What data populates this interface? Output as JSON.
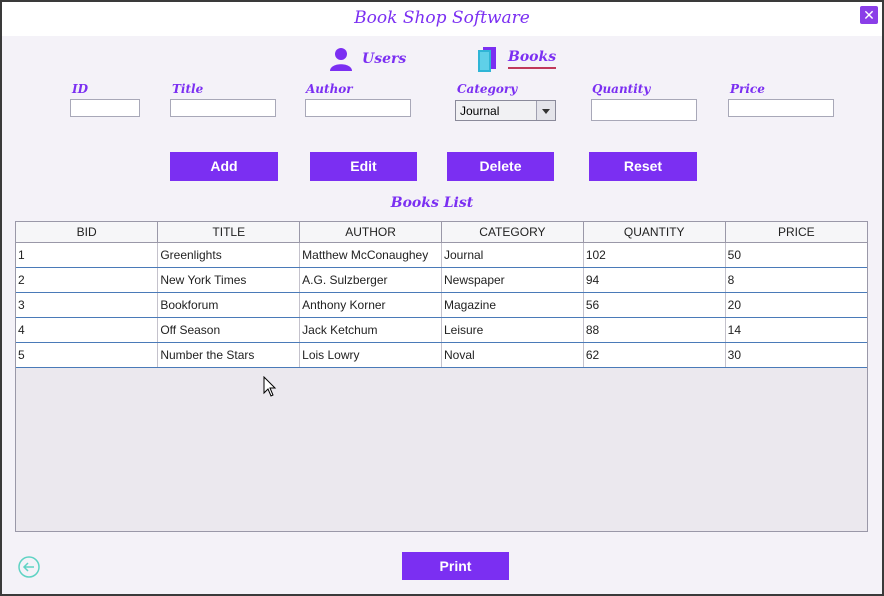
{
  "app": {
    "title": "Book Shop Software",
    "close_glyph": "✕"
  },
  "nav": {
    "users_label": "Users",
    "books_label": "Books"
  },
  "form": {
    "id_label": "ID",
    "title_label": "Title",
    "author_label": "Author",
    "category_label": "Category",
    "quantity_label": "Quantity",
    "price_label": "Price",
    "id_value": "",
    "title_value": "",
    "author_value": "",
    "category_value": "Journal",
    "quantity_value": "",
    "price_value": ""
  },
  "buttons": {
    "add": "Add",
    "edit": "Edit",
    "delete": "Delete",
    "reset": "Reset",
    "print": "Print"
  },
  "list": {
    "title": "Books List",
    "columns": [
      "BID",
      "TITLE",
      "AUTHOR",
      "CATEGORY",
      "QUANTITY",
      "PRICE"
    ],
    "rows": [
      [
        "1",
        "Greenlights",
        "Matthew McConaughey",
        "Journal",
        "102",
        "50"
      ],
      [
        "2",
        "New York Times",
        "A.G. Sulzberger",
        "Newspaper",
        "94",
        "8"
      ],
      [
        "3",
        "Bookforum",
        "Anthony Korner",
        "Magazine",
        "56",
        "20"
      ],
      [
        "4",
        "Off Season",
        "Jack Ketchum",
        "Leisure",
        "88",
        "14"
      ],
      [
        "5",
        "Number the Stars",
        "Lois Lowry",
        "Noval",
        "62",
        "30"
      ]
    ]
  },
  "colors": {
    "accent": "#7b2ff2",
    "background": "#f4f2f8",
    "back_icon": "#5fd3c4",
    "books_icon_a": "#2fb5d6",
    "books_icon_b": "#7b2ff2"
  },
  "icons": {
    "users": "user-icon",
    "books": "books-icon",
    "back": "back-arrow-icon",
    "close": "close-icon"
  }
}
